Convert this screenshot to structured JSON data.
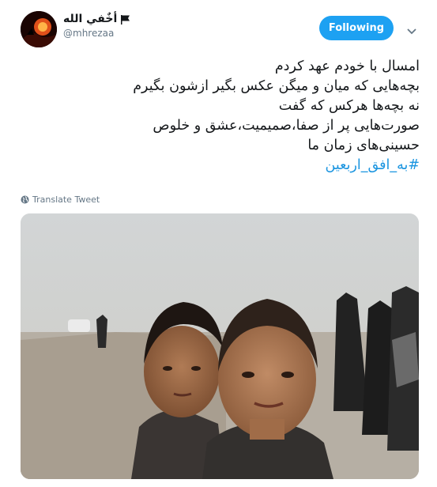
{
  "user": {
    "display_name": "أخٌفي الله",
    "handle": "@mhrezaa"
  },
  "follow_button": {
    "label": "Following"
  },
  "tweet": {
    "lines": [
      "امسال با خودم عهد کردم",
      "بچه‌هایی که میان و میگن عکس بگیر ازشون بگیرم",
      "نه بچه‌ها هرکس که گفت",
      "صورت‌هایی پر از صفا،صمیمیت،عشق و خلوص",
      "حسینی‌های زمان ما"
    ],
    "hashtag": "#به_افق_اربعین"
  },
  "translate": {
    "label": "Translate Tweet"
  },
  "icons": {
    "flag": "flag-icon",
    "chevron": "chevron-down-icon",
    "globe": "globe-icon"
  },
  "colors": {
    "accent": "#1da1f2",
    "link": "#1b95e0",
    "muted": "#657786"
  }
}
